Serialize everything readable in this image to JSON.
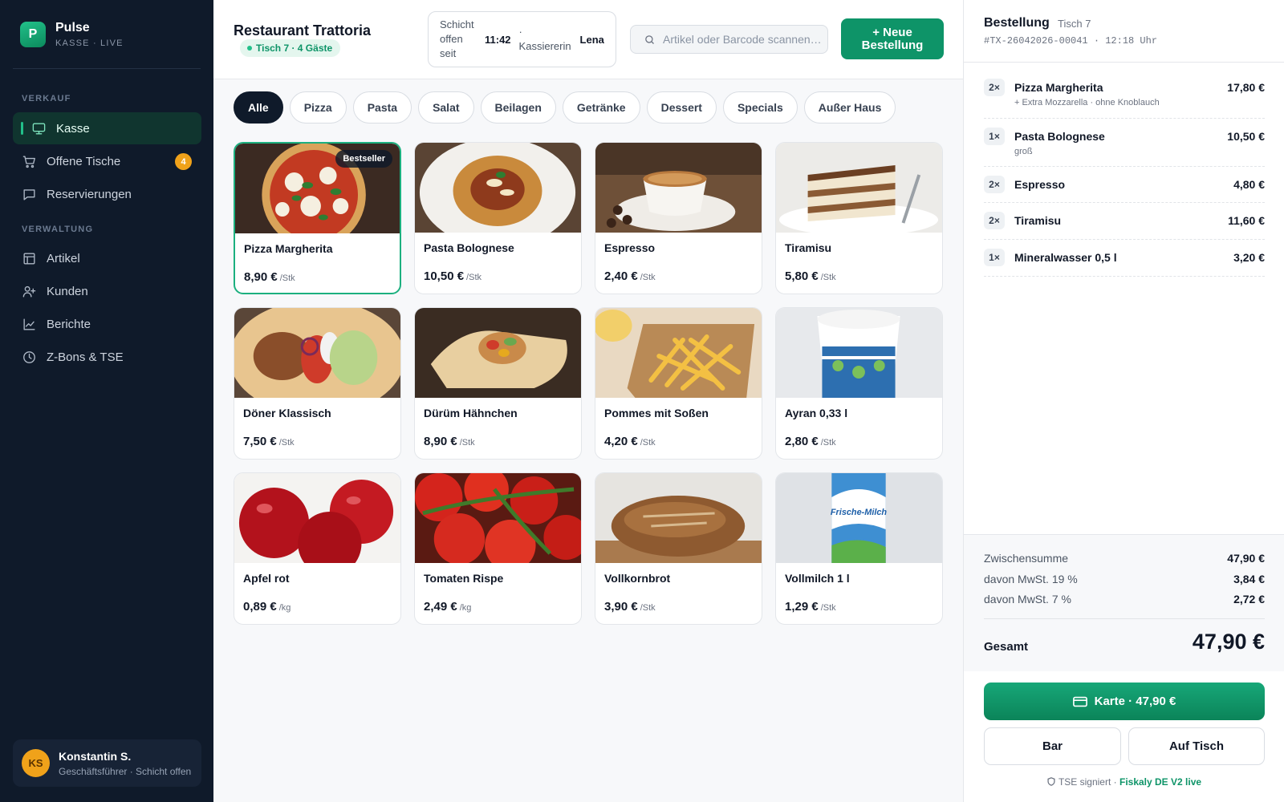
{
  "brand": {
    "initial": "P",
    "name": "Pulse",
    "subtitle": "KASSE · LIVE"
  },
  "sidebar": {
    "section_sales": "VERKAUF",
    "section_admin": "VERWALTUNG",
    "items": [
      {
        "label": "Kasse",
        "icon": "monitor-icon",
        "active": true
      },
      {
        "label": "Offene Tische",
        "icon": "cart-icon",
        "badge": "4"
      },
      {
        "label": "Reservierungen",
        "icon": "chat-icon"
      },
      {
        "label": "Artikel",
        "icon": "layout-icon"
      },
      {
        "label": "Kunden",
        "icon": "user-plus-icon"
      },
      {
        "label": "Berichte",
        "icon": "chart-icon"
      },
      {
        "label": "Z-Bons & TSE",
        "icon": "clock-icon"
      }
    ],
    "user": {
      "initials": "KS",
      "name": "Konstantin S.",
      "role": "Geschäftsführer · Schicht offen"
    }
  },
  "header": {
    "restaurant": "Restaurant Trattoria",
    "table_chip": "Tisch 7 · 4 Gäste",
    "shift_label": "Schicht offen seit",
    "shift_time": "11:42",
    "cashier_label": "· Kassiererin",
    "cashier_name": "Lena",
    "search_placeholder": "Artikel oder Barcode scannen…",
    "new_order": "+ Neue Bestellung"
  },
  "categories": [
    "Alle",
    "Pizza",
    "Pasta",
    "Salat",
    "Beilagen",
    "Getränke",
    "Dessert",
    "Specials",
    "Außer Haus"
  ],
  "products": [
    {
      "name": "Pizza Margherita",
      "price": "8,90 €",
      "unit": "/Stk",
      "badge": "Bestseller",
      "image": "pizza"
    },
    {
      "name": "Pasta Bolognese",
      "price": "10,50 €",
      "unit": "/Stk",
      "image": "pasta"
    },
    {
      "name": "Espresso",
      "price": "2,40 €",
      "unit": "/Stk",
      "image": "espresso"
    },
    {
      "name": "Tiramisu",
      "price": "5,80 €",
      "unit": "/Stk",
      "image": "tiramisu"
    },
    {
      "name": "Döner Klassisch",
      "price": "7,50 €",
      "unit": "/Stk",
      "image": "doener"
    },
    {
      "name": "Dürüm Hähnchen",
      "price": "8,90 €",
      "unit": "/Stk",
      "image": "wrap"
    },
    {
      "name": "Pommes mit Soßen",
      "price": "4,20 €",
      "unit": "/Stk",
      "image": "fries"
    },
    {
      "name": "Ayran 0,33 l",
      "price": "2,80 €",
      "unit": "/Stk",
      "image": "ayran"
    },
    {
      "name": "Apfel rot",
      "price": "0,89 €",
      "unit": "/kg",
      "image": "apples"
    },
    {
      "name": "Tomaten Rispe",
      "price": "2,49 €",
      "unit": "/kg",
      "image": "tomatoes"
    },
    {
      "name": "Vollkornbrot",
      "price": "3,90 €",
      "unit": "/Stk",
      "image": "bread"
    },
    {
      "name": "Vollmilch 1 l",
      "price": "1,29 €",
      "unit": "/Stk",
      "image": "milk",
      "pack_text": "Frische-Milch"
    }
  ],
  "order": {
    "title": "Bestellung",
    "table": "Tisch 7",
    "id": "#TX-26042026-00041 · 12:18 Uhr",
    "items": [
      {
        "qty": "2×",
        "name": "Pizza Margherita",
        "note": "+ Extra Mozzarella · ohne Knoblauch",
        "price": "17,80 €"
      },
      {
        "qty": "1×",
        "name": "Pasta Bolognese",
        "note": "groß",
        "price": "10,50 €"
      },
      {
        "qty": "2×",
        "name": "Espresso",
        "note": "",
        "price": "4,80 €"
      },
      {
        "qty": "2×",
        "name": "Tiramisu",
        "note": "",
        "price": "11,60 €"
      },
      {
        "qty": "1×",
        "name": "Mineralwasser 0,5 l",
        "note": "",
        "price": "3,20 €"
      }
    ],
    "subtotal_label": "Zwischensumme",
    "subtotal": "47,90 €",
    "vat19_label": "davon MwSt. 19 %",
    "vat19": "3,84 €",
    "vat7_label": "davon MwSt. 7 %",
    "vat7": "2,72 €",
    "total_label": "Gesamt",
    "total": "47,90 €",
    "pay_card": "Karte · 47,90 €",
    "pay_cash": "Bar",
    "pay_table": "Auf Tisch",
    "tse_text": "TSE signiert ·",
    "tse_live": "Fiskaly DE V2 live"
  },
  "colors": {
    "accent": "#0e9468",
    "sidebar_bg": "#0f1a2a",
    "badge": "#f0a21a"
  }
}
